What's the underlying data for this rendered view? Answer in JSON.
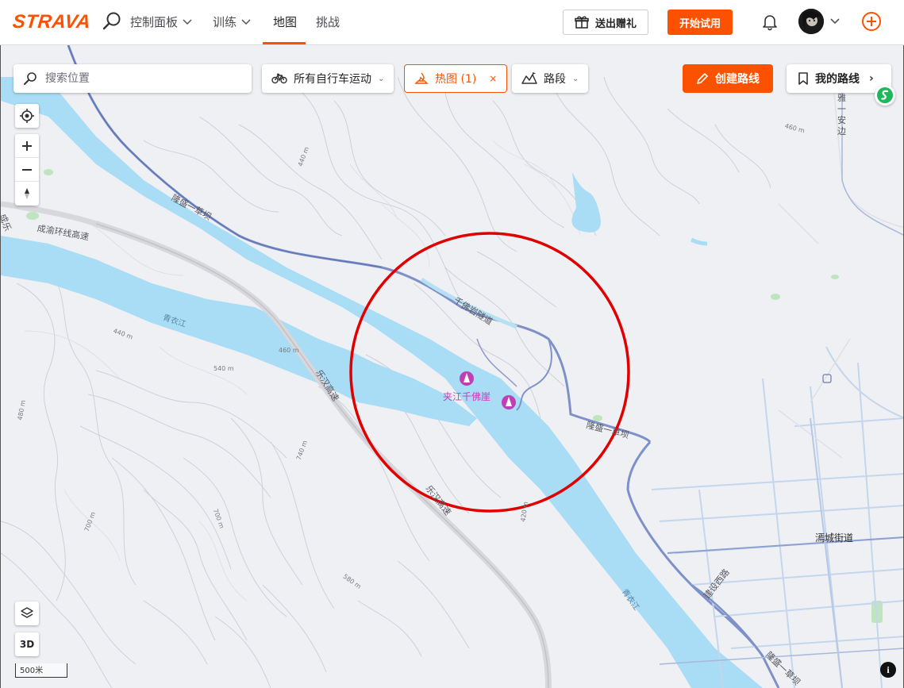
{
  "nav": {
    "logo": "STRAVA",
    "items": [
      {
        "label": "控制面板"
      },
      {
        "label": "训练"
      },
      {
        "label": "地图"
      },
      {
        "label": "挑战"
      }
    ],
    "gift_label": "送出赠礼",
    "trial_label": "开始试用",
    "accent": "#fc5200"
  },
  "map_ui": {
    "search_placeholder": "搜索位置",
    "sport_filter": "所有自行车运动",
    "heatmap_label": "热图 (1)",
    "heatmap_close": "×",
    "segments_label": "路段",
    "create_route_label": "创建路线",
    "my_routes_label": "我的路线",
    "three_d_label": "3D",
    "scale_label": "500米",
    "info_label": "i"
  },
  "map_labels": {
    "road_longsheng_top": "隆盛一草坝",
    "road_chengyu": "成渝环线高速",
    "tunnel": "千佛岩隧道",
    "poi": "夹江千佛崖",
    "road_longsheng_bottom": "隆盛一草坝",
    "expressway_upper": "乐汉高速",
    "expressway_lower": "乐汉高速",
    "river_upper": "青衣江",
    "river_lower": "青衣江",
    "town": "漹城街道",
    "road_jianshe": "建设西路",
    "road_longsheng_corner": "隆盛一草坝",
    "road_right_vertical": "雅一安边",
    "road_left_edge": "成乐",
    "contour_440_a": "440 m",
    "contour_440_b": "440 m",
    "contour_460_a": "460 m",
    "contour_460_b": "460 m",
    "contour_480": "480 m",
    "contour_540": "540 m",
    "contour_740": "740 m",
    "contour_700_a": "700 m",
    "contour_700_b": "700 m",
    "contour_580": "580 m",
    "contour_420": "420 m"
  }
}
